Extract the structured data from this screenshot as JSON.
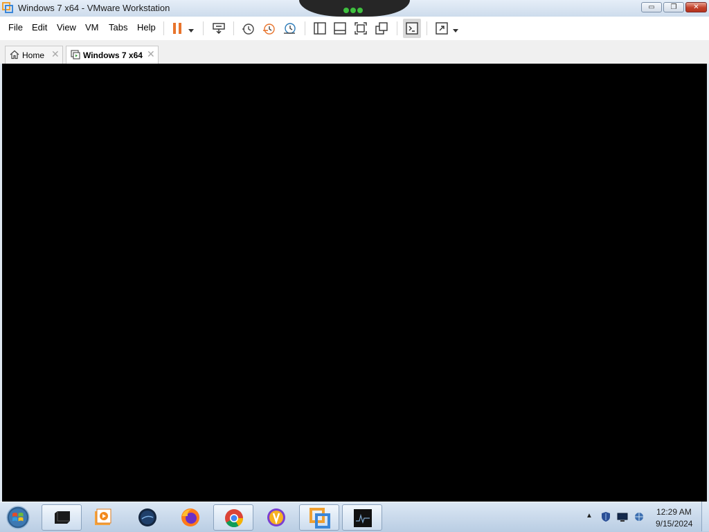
{
  "window": {
    "title": "Windows 7 x64 - VMware Workstation",
    "minimize_glyph": "▭",
    "maximize_glyph": "❐",
    "close_glyph": "✕"
  },
  "menu": {
    "items": [
      "File",
      "Edit",
      "View",
      "VM",
      "Tabs",
      "Help"
    ]
  },
  "toolbar": {
    "icons": [
      "pause-icon",
      "send-ctrl-alt-del-icon",
      "take-snapshot-icon",
      "revert-snapshot-icon",
      "snapshot-manager-icon",
      "show-library-icon",
      "thumbnail-bar-icon",
      "full-screen-icon",
      "unity-icon",
      "console-view-icon",
      "stretch-guest-icon"
    ]
  },
  "tabs": [
    {
      "label": "Home",
      "close": "✕",
      "active": false
    },
    {
      "label": "Windows 7 x64",
      "close": "✕",
      "active": true
    }
  ],
  "taskbar": {
    "apps": [
      "terminal-app-icon",
      "media-player-icon",
      "globe-app-icon",
      "firefox-icon",
      "chrome-icon",
      "vpn-app-icon",
      "vmware-workstation-icon",
      "system-monitor-icon"
    ],
    "tray_arrow": "▲",
    "clock_time": "12:29 AM",
    "clock_date": "9/15/2024"
  },
  "colors": {
    "vm_screen": "#000000",
    "pause_orange": "#e8742c",
    "close_red": "#c2412b",
    "unity_green": "#3fbf3f"
  }
}
